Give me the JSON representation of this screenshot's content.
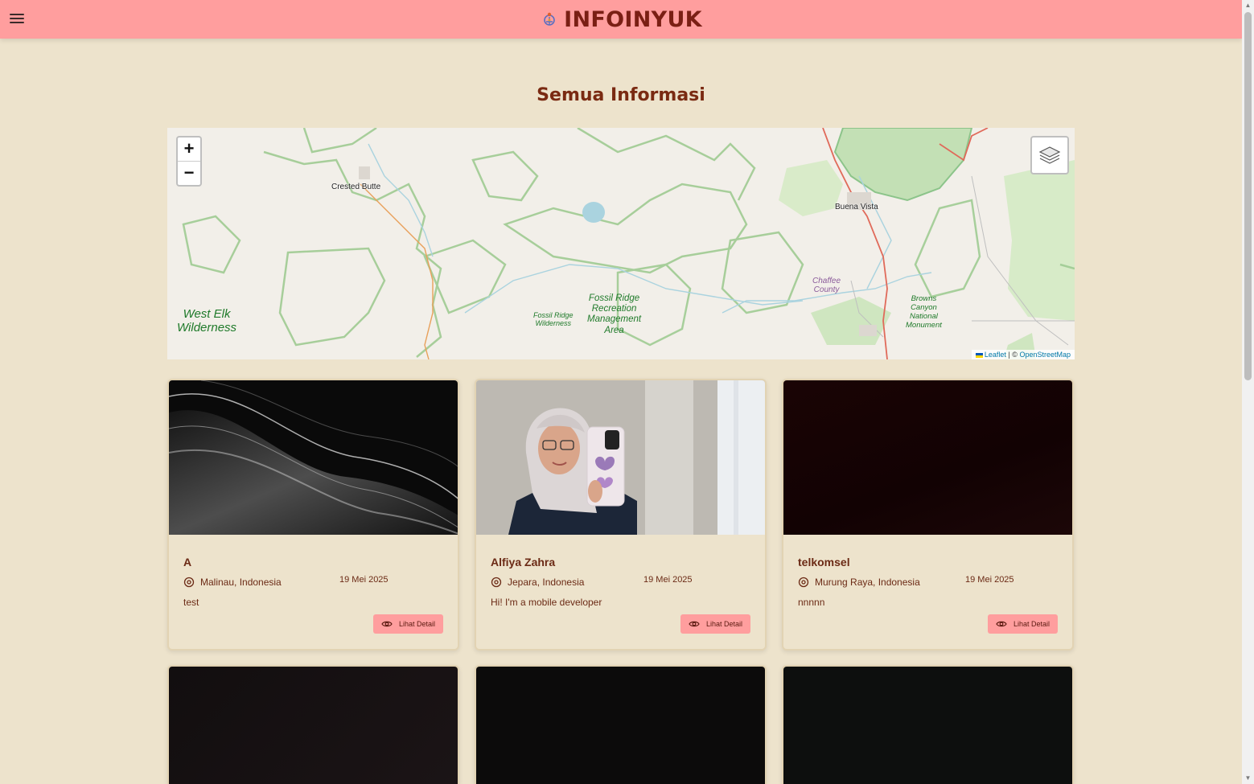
{
  "navbar": {
    "brand": "INFOINYUK",
    "menu_icon": "hamburger-menu-icon",
    "logo_icon": "brand-logo-icon",
    "bg_color": "#ff9e9e"
  },
  "page": {
    "title": "Semua Informasi",
    "bg_color": "#ede3cc",
    "accent_color": "#7a2a12"
  },
  "map": {
    "zoom_in": "+",
    "zoom_out": "−",
    "layers_icon": "layers-icon",
    "places": [
      "Crested Butte",
      "Buena Vista"
    ],
    "parks": [
      "West Elk Wilderness",
      "Fossil Ridge Wilderness",
      "Fossil Ridge Recreation Management Area",
      "Browns Canyon National Monument"
    ],
    "park_lines": {
      "west_elk": [
        "West Elk",
        "Wilderness"
      ],
      "fossil_ridge_wild": [
        "Fossil Ridge",
        "Wilderness"
      ],
      "fossil_ridge_rec": [
        "Fossil Ridge",
        "Recreation",
        "Management",
        "Area"
      ],
      "browns": [
        "Browns",
        "Canyon",
        "National",
        "Monument"
      ]
    },
    "county": [
      "Chaffee",
      "County"
    ],
    "attribution": {
      "leaflet": "Leaflet",
      "separator": "| ©",
      "osm": "OpenStreetMap"
    }
  },
  "cards": [
    {
      "title": "A",
      "location": "Malinau, Indonesia",
      "date": "19 Mei 2025",
      "description": "test",
      "button": "Lihat Detail",
      "image": "dark-silk-waves"
    },
    {
      "title": "Alfiya Zahra",
      "location": "Jepara, Indonesia",
      "date": "19 Mei 2025",
      "description": "Hi! I'm a mobile developer",
      "button": "Lihat Detail",
      "image": "selfie-photo"
    },
    {
      "title": "telkomsel",
      "location": "Murung Raya, Indonesia",
      "date": "19 Mei 2025",
      "description": "nnnnn",
      "button": "Lihat Detail",
      "image": "dark-red-texture"
    }
  ]
}
